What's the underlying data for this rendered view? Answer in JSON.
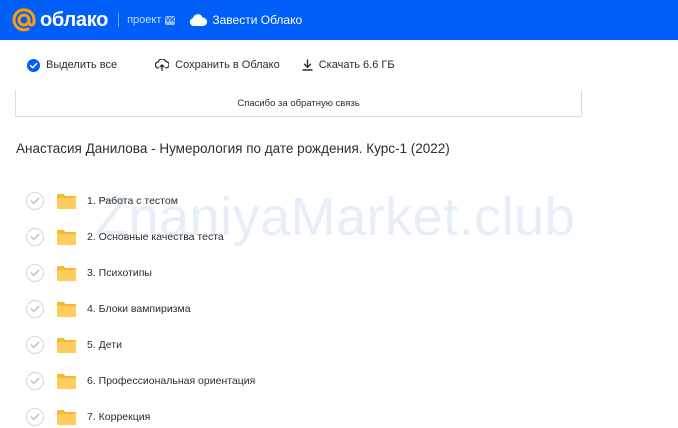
{
  "header": {
    "logo_text": "облако",
    "project_label": "проект",
    "project_badge": "VK",
    "get_cloud_label": "Завести Облако",
    "brand_color": "#005ff9"
  },
  "toolbar": {
    "select_all_label": "Выделить все",
    "save_label": "Сохранить в Облако",
    "download_label": "Скачать 6.6 ГБ"
  },
  "feedback": {
    "text": "Спасибо за обратную связь"
  },
  "folder_title": "Анастасия Данилова - Нумерология по дате рождения. Курс-1 (2022)",
  "watermark": "ZnaniyaMarket.club",
  "files": [
    {
      "name": "1. Работа с тестом"
    },
    {
      "name": "2. Основные качества теста"
    },
    {
      "name": "3. Психотипы"
    },
    {
      "name": "4. Блоки вампиризма"
    },
    {
      "name": "5. Дети"
    },
    {
      "name": "6. Профессиональная ориентация"
    },
    {
      "name": "7. Коррекция"
    }
  ]
}
